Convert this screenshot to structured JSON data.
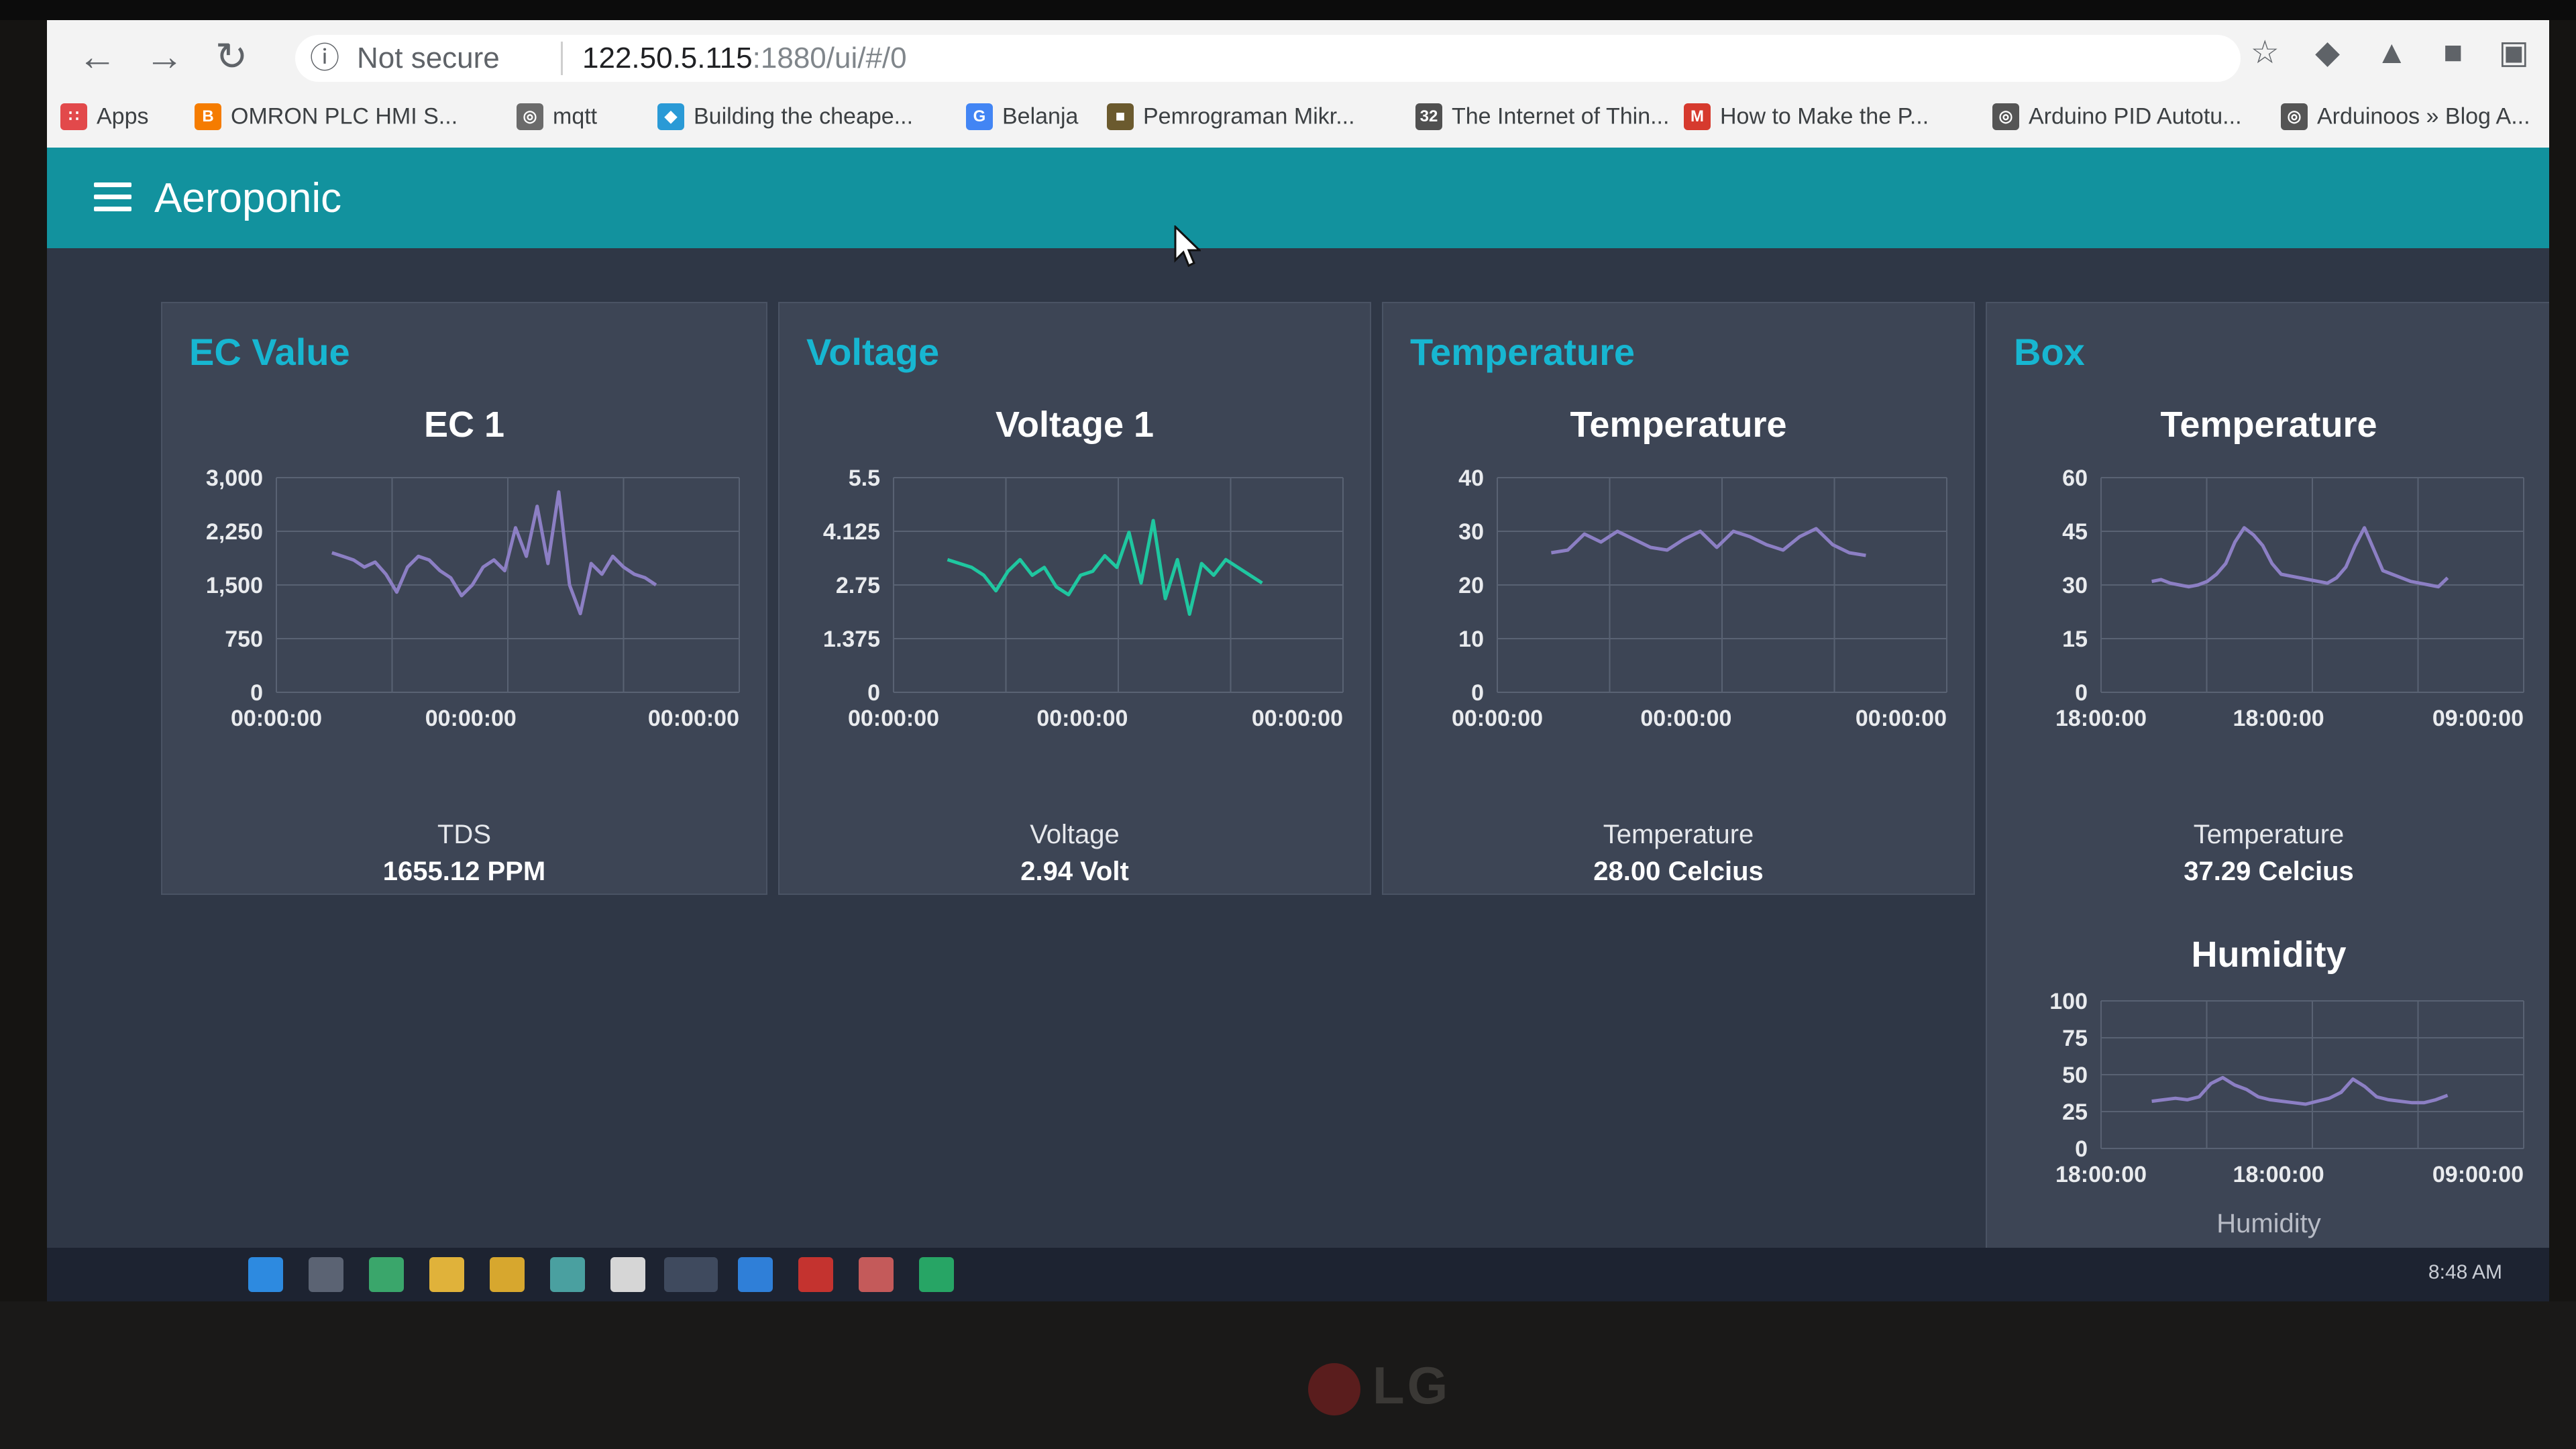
{
  "browser": {
    "security_label": "Not secure",
    "url_host": "122.50.5.115",
    "url_path": ":1880/ui/#/0",
    "bookmarks": [
      {
        "label": "Apps",
        "icon": "apps-grid-icon"
      },
      {
        "label": "OMRON PLC HMI S...",
        "icon": "blogger-icon"
      },
      {
        "label": "mqtt",
        "icon": "globe-icon"
      },
      {
        "label": "Building the cheape...",
        "icon": "diamond-icon"
      },
      {
        "label": "Belanja",
        "icon": "google-icon"
      },
      {
        "label": "Pemrograman Mikr...",
        "icon": "site-icon"
      },
      {
        "label": "The Internet of Thin...",
        "icon": "calendar-icon"
      },
      {
        "label": "How to Make the P...",
        "icon": "my-icon"
      },
      {
        "label": "Arduino PID Autotu...",
        "icon": "globe-icon"
      },
      {
        "label": "Arduinoos » Blog A...",
        "icon": "globe-icon"
      }
    ]
  },
  "dashboard": {
    "title": "Aeroponic"
  },
  "cards": {
    "ec": {
      "title": "EC Value",
      "chart_title": "EC 1",
      "label": "TDS",
      "value": "1655.12 PPM"
    },
    "voltage": {
      "title": "Voltage",
      "chart_title": "Voltage 1",
      "label": "Voltage",
      "value": "2.94 Volt"
    },
    "temperature": {
      "title": "Temperature",
      "chart_title": "Temperature",
      "label": "Temperature",
      "value": "28.00 Celcius"
    },
    "box": {
      "title": "Box",
      "temp_chart_title": "Temperature",
      "temp_label": "Temperature",
      "temp_value": "37.29 Celcius",
      "hum_chart_title": "Humidity",
      "hum_label": "Humidity"
    }
  },
  "taskbar": {
    "time": "8:48 AM"
  },
  "colors": {
    "header": "#12929e",
    "card_bg": "#3d4555",
    "card_title": "#17b6d1",
    "series_purple": "#8c7fc4",
    "series_teal": "#1fc7a0",
    "page_bg": "#2f3746"
  },
  "chart_data": [
    {
      "type": "line",
      "title": "EC 1",
      "y_ticks": [
        "3,000",
        "2,250",
        "1,500",
        "750",
        "0"
      ],
      "x_ticks": [
        "00:00:00",
        "00:00:00",
        "00:00:00"
      ],
      "ylim": [
        0,
        3000
      ],
      "series": [
        {
          "color": "#8c7fc4",
          "values": [
            1950,
            1900,
            1850,
            1750,
            1820,
            1650,
            1400,
            1750,
            1900,
            1850,
            1700,
            1600,
            1350,
            1500,
            1750,
            1850,
            1700,
            2300,
            1900,
            2600,
            1800,
            2800,
            1500,
            1100,
            1800,
            1650,
            1900,
            1750,
            1650,
            1600,
            1500
          ]
        }
      ]
    },
    {
      "type": "line",
      "title": "Voltage 1",
      "y_ticks": [
        "5.5",
        "4.125",
        "2.75",
        "1.375",
        "0"
      ],
      "x_ticks": [
        "00:00:00",
        "00:00:00",
        "00:00:00"
      ],
      "ylim": [
        0,
        5.5
      ],
      "series": [
        {
          "color": "#1fc7a0",
          "values": [
            3.4,
            3.3,
            3.2,
            3.0,
            2.6,
            3.1,
            3.4,
            3.0,
            3.2,
            2.7,
            2.5,
            3.0,
            3.1,
            3.5,
            3.2,
            4.1,
            2.8,
            4.4,
            2.4,
            3.4,
            2.0,
            3.3,
            3.0,
            3.4,
            3.2,
            3.0,
            2.8
          ]
        }
      ]
    },
    {
      "type": "line",
      "title": "Temperature",
      "y_ticks": [
        "40",
        "30",
        "20",
        "10",
        "0"
      ],
      "x_ticks": [
        "00:00:00",
        "00:00:00",
        "00:00:00"
      ],
      "ylim": [
        0,
        40
      ],
      "series": [
        {
          "color": "#8c7fc4",
          "values": [
            26,
            26.5,
            29.5,
            28,
            30,
            28.5,
            27,
            26.5,
            28.5,
            30,
            27,
            30,
            29,
            27.5,
            26.5,
            29,
            30.5,
            27.5,
            26,
            25.5
          ]
        }
      ]
    },
    {
      "type": "line",
      "title": "Temperature",
      "y_ticks": [
        "60",
        "45",
        "30",
        "15",
        "0"
      ],
      "x_ticks": [
        "18:00:00",
        "18:00:00",
        "09:00:00"
      ],
      "ylim": [
        0,
        60
      ],
      "series": [
        {
          "color": "#8c7fc4",
          "values": [
            31,
            31.5,
            30.5,
            30,
            29.5,
            30,
            31,
            33,
            36,
            42,
            46,
            44,
            41,
            36,
            33,
            32.5,
            32,
            31.5,
            31,
            30.5,
            32,
            35,
            41,
            46,
            40,
            34,
            33,
            32,
            31,
            30.5,
            30,
            29.5,
            32
          ]
        }
      ]
    },
    {
      "type": "line",
      "title": "Humidity",
      "y_ticks": [
        "100",
        "75",
        "50",
        "25",
        "0"
      ],
      "x_ticks": [
        "18:00:00",
        "18:00:00",
        "09:00:00"
      ],
      "ylim": [
        0,
        100
      ],
      "series": [
        {
          "color": "#8c7fc4",
          "values": [
            32,
            33,
            34,
            33,
            35,
            44,
            48,
            43,
            40,
            35,
            33,
            32,
            31,
            30,
            32,
            34,
            38,
            47,
            42,
            35,
            33,
            32,
            31,
            31,
            33,
            36
          ]
        }
      ]
    }
  ]
}
